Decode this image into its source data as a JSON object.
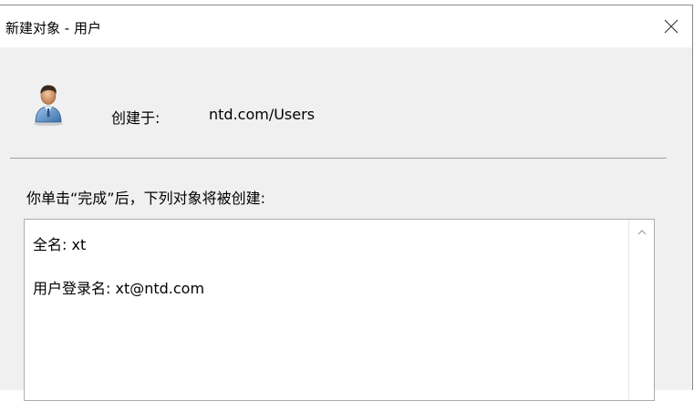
{
  "dialog": {
    "title": "新建对象 - 用户"
  },
  "header": {
    "created_label": "创建于:",
    "created_value": "ntd.com/Users"
  },
  "instruction": "你单击“完成”后，下列对象将被创建:",
  "summary": {
    "lines": [
      "全名: xt",
      "用户登录名: xt@ntd.com"
    ]
  },
  "icons": {
    "close": "close-icon",
    "user": "user-icon",
    "scroll_up": "chevron-up-icon"
  },
  "colors": {
    "dialog_bg": "#f0f0f0",
    "titlebar_bg": "#ffffff",
    "divider": "#a0a0a0"
  }
}
